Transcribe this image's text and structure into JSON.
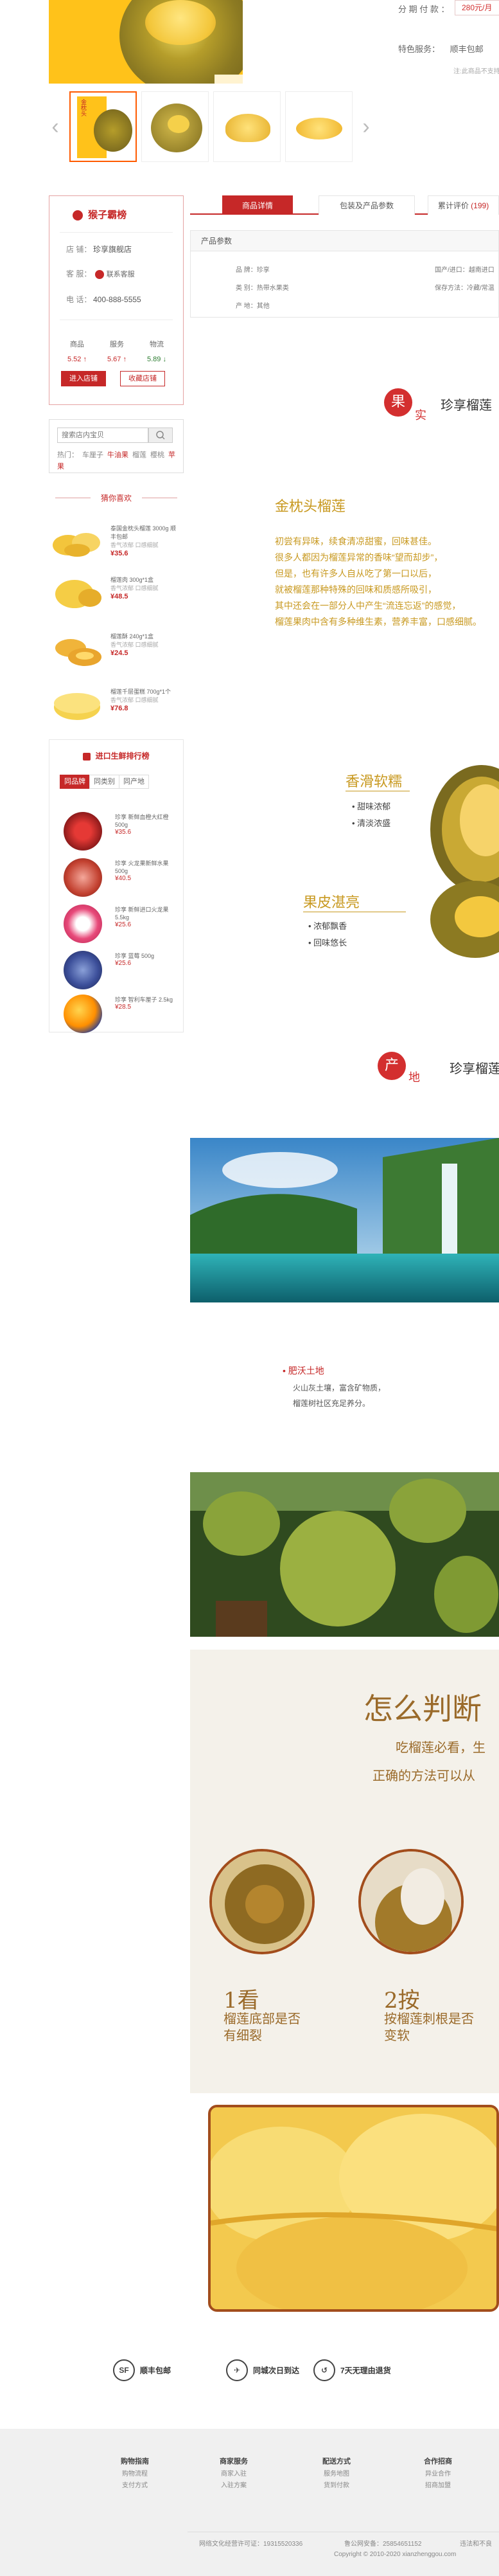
{
  "product": {
    "installment_label": "分 期 付 款 ：",
    "installment_value": "280元/月",
    "special_service_label": "特色服务：",
    "special_service_value": "顺丰包邮",
    "note": "注:此商品不支持…",
    "thumb_badge": "金枕头"
  },
  "shop": {
    "logo": "猴子霸榜",
    "name_label": "店 铺：",
    "name_value": "珍享旗舰店",
    "service_label": "客 服：",
    "service_value": "联系客服",
    "phone_label": "电 话：",
    "phone_value": "400-888-5555",
    "scores": [
      {
        "label": "商品",
        "value": "5.52"
      },
      {
        "label": "服务",
        "value": "5.67"
      },
      {
        "label": "物流",
        "value": "5.89"
      }
    ],
    "enter_button": "进入店铺",
    "fav_button": "收藏店铺"
  },
  "search": {
    "placeholder": "搜索店内宝贝",
    "hot_label": "热门：",
    "hot_items": [
      "车厘子",
      "牛油果",
      "榴莲",
      "樱桃"
    ],
    "hot_red": "牛油果",
    "hot_red2": "苹果"
  },
  "recommend": {
    "title": "猜你喜欢",
    "items": [
      {
        "name": "泰国金枕头榴莲 3000g 顺丰包邮",
        "sub": "香气浓郁 口感细腻",
        "price": "¥35.6"
      },
      {
        "name": "榴莲肉 300g*1盒",
        "sub": "香气浓郁 口感细腻",
        "price": "¥48.5"
      },
      {
        "name": "榴莲酥 240g*1盒",
        "sub": "香气浓郁 口感细腻",
        "price": "¥24.5"
      },
      {
        "name": "榴莲千层蛋糕 700g*1个",
        "sub": "香气浓郁 口感细腻",
        "price": "¥76.8"
      }
    ]
  },
  "imports": {
    "title": "进口生鲜排行榜",
    "tabs": [
      "同品牌",
      "同类别",
      "同产地"
    ],
    "items": [
      {
        "name": "珍享 新鲜血橙大红橙 500g",
        "price": "¥35.6"
      },
      {
        "name": "珍享 火龙果新鲜水果 500g",
        "price": "¥40.5"
      },
      {
        "name": "珍享 新鲜进口火龙果 5.5kg",
        "price": "¥25.6"
      },
      {
        "name": "珍享 蓝莓 500g",
        "price": "¥25.6"
      },
      {
        "name": "珍享 智利车厘子 2.5kg",
        "price": "¥28.5"
      }
    ]
  },
  "tabs": [
    {
      "label": "商品详情"
    },
    {
      "label": "包装及产品参数"
    },
    {
      "label": "累计评价",
      "count": "(199)"
    }
  ],
  "params": {
    "heading": "产品参数",
    "items": [
      "品  牌：珍享",
      "类  别：热带水果类",
      "产  地：其他",
      "国产/进口：越南进口",
      "保存方法：冷藏/常温"
    ]
  },
  "section_real": {
    "badge": "果",
    "badge_small": "实",
    "title": "珍享榴莲"
  },
  "intro": {
    "title": "金枕头榴莲",
    "lines": [
      "初尝有异味，续食清凉甜蜜，回味甚佳。",
      "很多人都因为榴莲异常的香味“望而却步”，",
      "但是，也有许多人自从吃了第一口以后，",
      "就被榴莲那种特殊的回味和质感所吸引，",
      "其中还会在一部分人中产生“流连忘返”的感觉，",
      "榴莲果肉中含有多种维生素，营养丰富，口感细腻。"
    ]
  },
  "features": {
    "f1_title": "香滑软糯",
    "f1_bullets": [
      "• 甜味浓郁",
      "• 清淡浓盛"
    ],
    "f2_title": "果皮湛亮",
    "f2_bullets": [
      "• 浓郁飘香",
      "• 回味悠长"
    ]
  },
  "section_origin": {
    "badge": "产",
    "badge_small": "地",
    "title": "珍享榴莲"
  },
  "soil": {
    "title": "• 肥沃土地",
    "lines": [
      "火山灰土壤，富含矿物质，",
      "榴莲树社区充足养分。"
    ]
  },
  "judge": {
    "title": "怎么判断",
    "sub1": "吃榴莲必看，生",
    "sub2": "正确的方法可以从",
    "step1_num": "1看",
    "step1_text": [
      "榴莲底部是否",
      "有细裂"
    ],
    "step2_num": "2按",
    "step2_text": [
      "按榴莲刺根是否",
      "变软"
    ]
  },
  "services": [
    {
      "icon": "SF",
      "label": "顺丰包邮"
    },
    {
      "icon": "✈",
      "label": "同城次日到达"
    },
    {
      "icon": "↺",
      "label": "7天无理由退货"
    }
  ],
  "footer": {
    "cols": [
      {
        "h": "购物指南",
        "i": [
          "购物流程",
          "支付方式"
        ]
      },
      {
        "h": "商家服务",
        "i": [
          "商家入驻",
          "入驻方案"
        ]
      },
      {
        "h": "配送方式",
        "i": [
          "服务地图",
          "货到付款"
        ]
      },
      {
        "h": "合作招商",
        "i": [
          "异业合作",
          "招商加盟"
        ]
      }
    ],
    "icp": "网络文化经营许可证：19315520336",
    "license": "鲁公网安备：25854651152",
    "more": "违法和不良",
    "copyright": "Copyright © 2010-2020 xianzhenggou.com"
  }
}
